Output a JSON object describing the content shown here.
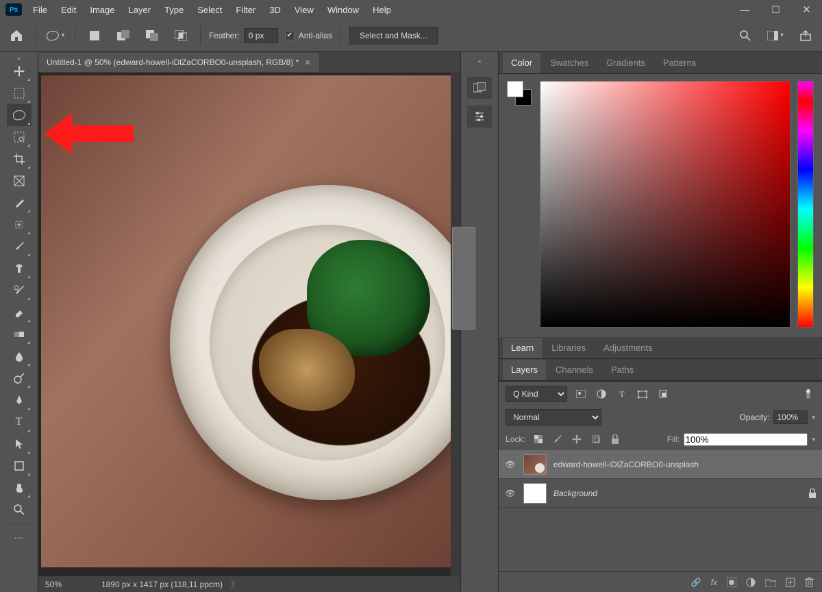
{
  "menu": {
    "file": "File",
    "edit": "Edit",
    "image": "Image",
    "layer": "Layer",
    "type": "Type",
    "select": "Select",
    "filter": "Filter",
    "threeD": "3D",
    "view": "View",
    "window": "Window",
    "help": "Help"
  },
  "options": {
    "feather_label": "Feather:",
    "feather_value": "0 px",
    "antialias": "Anti-alias",
    "selectmask": "Select and Mask..."
  },
  "document": {
    "tab_title": "Untitled-1 @ 50% (edward-howell-iDlZaCORBO0-unsplash, RGB/8) *",
    "zoom": "50%",
    "dims": "1890 px x 1417 px (118,11 ppcm)"
  },
  "panels": {
    "color_tabs": {
      "color": "Color",
      "swatches": "Swatches",
      "gradients": "Gradients",
      "patterns": "Patterns"
    },
    "mid_tabs": {
      "learn": "Learn",
      "libraries": "Libraries",
      "adjustments": "Adjustments"
    },
    "layer_tabs": {
      "layers": "Layers",
      "channels": "Channels",
      "paths": "Paths"
    }
  },
  "layers": {
    "filter_kind": "Kind",
    "blend_mode": "Normal",
    "opacity_label": "Opacity:",
    "opacity_value": "100%",
    "lock_label": "Lock:",
    "fill_label": "Fill:",
    "fill_value": "100%",
    "items": [
      {
        "name": "edward-howell-iDlZaCORBO0-unsplash",
        "locked": false
      },
      {
        "name": "Background",
        "locked": true
      }
    ],
    "foot": {
      "link": "⛓",
      "fx": "fx",
      "mask": "◐",
      "adj": "◑",
      "group": "▭",
      "new": "⊞",
      "trash": "🗑"
    }
  },
  "kind_prefix": "Q"
}
